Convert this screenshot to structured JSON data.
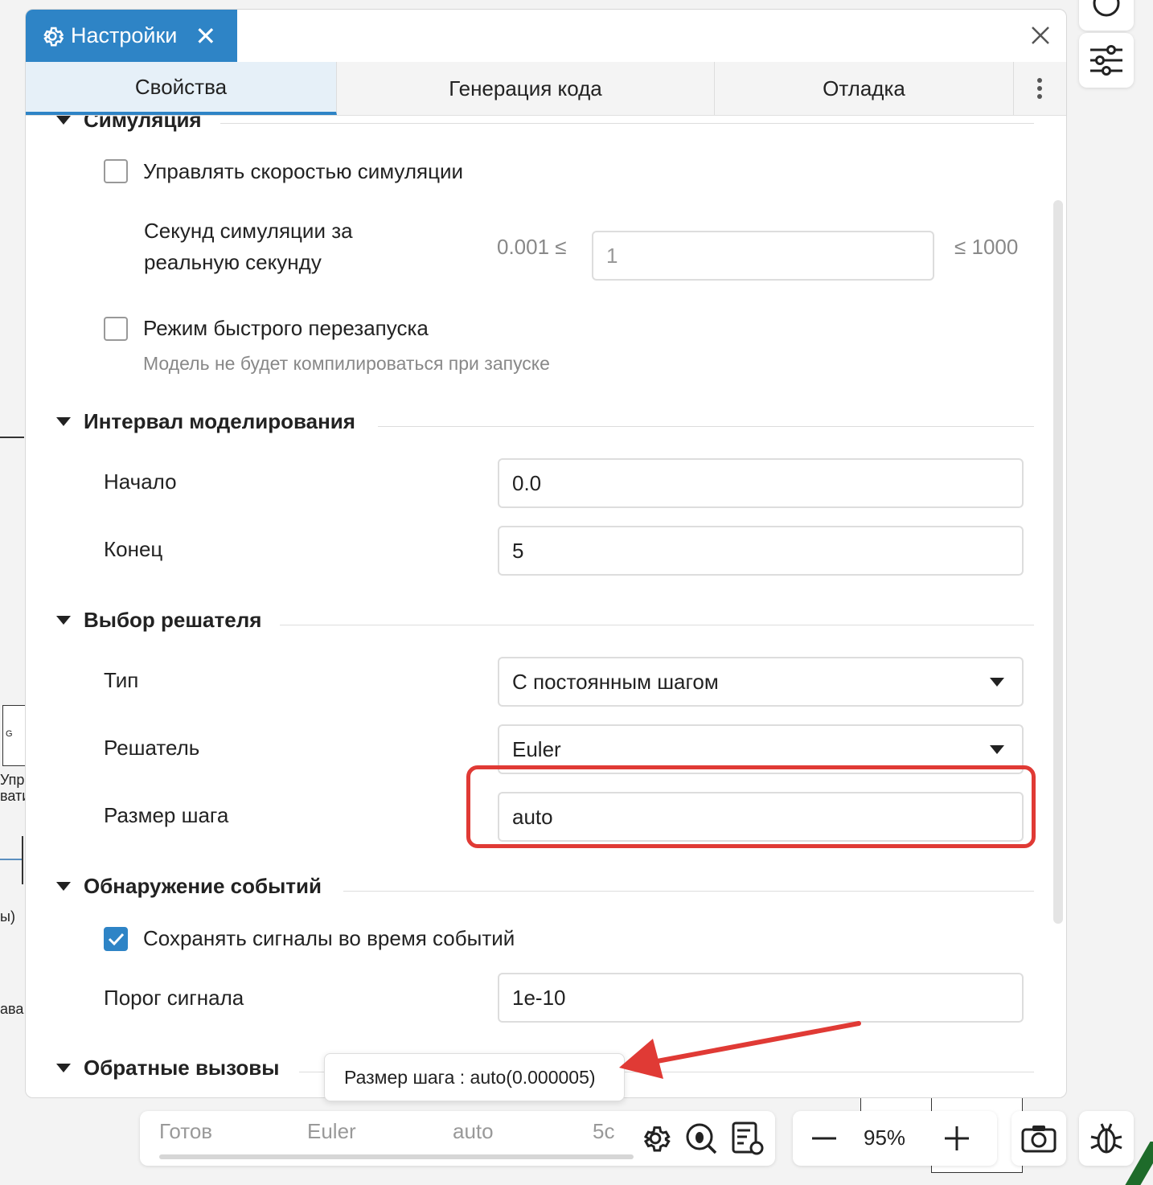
{
  "background": {
    "fragments": [
      "G",
      "Упра",
      "вати",
      "ы)",
      "ава"
    ]
  },
  "panel": {
    "doc_tab_label": "Настройки",
    "subtabs": [
      "Свойства",
      "Генерация кода",
      "Отладка"
    ]
  },
  "sections": {
    "simulation": {
      "title": "Симуляция",
      "speed_control_label": "Управлять скоростью симуляции",
      "speed_control_checked": false,
      "sim_seconds_label_line1": "Секунд симуляции за",
      "sim_seconds_label_line2": "реальную секунду",
      "sim_seconds_min": "0.001 ≤",
      "sim_seconds_value": "1",
      "sim_seconds_max": "≤ 1000",
      "fast_restart_label": "Режим быстрого перезапуска",
      "fast_restart_checked": false,
      "fast_restart_hint": "Модель не будет компилироваться при запуске"
    },
    "interval": {
      "title": "Интервал моделирования",
      "start_label": "Начало",
      "start_value": "0.0",
      "end_label": "Конец",
      "end_value": "5"
    },
    "solver": {
      "title": "Выбор решателя",
      "type_label": "Тип",
      "type_value": "С постоянным шагом",
      "solver_label": "Решатель",
      "solver_value": "Euler",
      "step_label": "Размер шага",
      "step_value": "auto"
    },
    "events": {
      "title": "Обнаружение событий",
      "save_signals_label": "Сохранять сигналы во время событий",
      "save_signals_checked": true,
      "threshold_label": "Порог сигнала",
      "threshold_value": "1e-10"
    },
    "callbacks": {
      "title": "Обратные вызовы"
    }
  },
  "tooltip": {
    "text": "Размер шага : auto(0.000005)"
  },
  "statusbar": {
    "state": "Готов",
    "solver": "Euler",
    "step": "auto",
    "time": "5с",
    "progress": 0
  },
  "zoom": {
    "value": "95%"
  },
  "colors": {
    "accent": "#2e84c6",
    "highlight": "#e03a35"
  }
}
